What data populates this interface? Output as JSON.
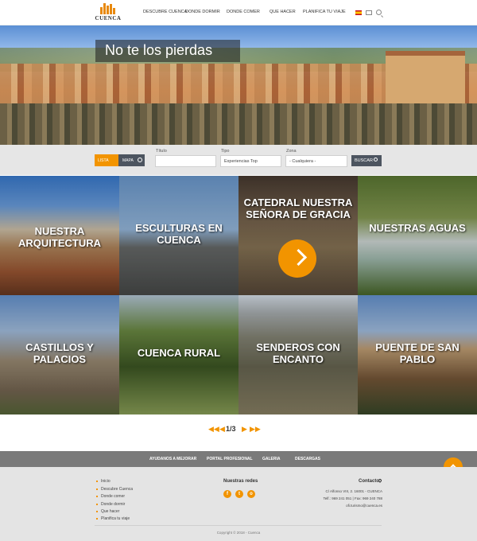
{
  "header": {
    "logo_text": "CUENCA",
    "nav": [
      "DESCUBRE CUENCA",
      "DONDE DORMIR",
      "DONDE COMER",
      "QUE HACER",
      "PLANIFICA TU VIAJE"
    ],
    "icons": [
      "spain-flag-icon",
      "mail-icon",
      "search-icon"
    ]
  },
  "hero": {
    "title": "No te los pierdas"
  },
  "filter": {
    "lista_label": "LISTA",
    "mapa_label": "MAPA",
    "titulo_label": "Título",
    "titulo_value": "",
    "tipo_label": "Tipo",
    "tipo_value": "Experiencias Top",
    "zona_label": "Zona",
    "zona_value": "- Cualquiera -",
    "buscar_label": "BUSCAR"
  },
  "tiles": [
    {
      "title": "NUESTRA ARQUITECTURA"
    },
    {
      "title": "ESCULTURAS EN CUENCA"
    },
    {
      "title": "CATEDRAL NUESTRA SEÑORA DE GRACIA"
    },
    {
      "title": "NUESTRAS AGUAS"
    },
    {
      "title": "CASTILLOS Y PALACIOS"
    },
    {
      "title": "CUENCA RURAL"
    },
    {
      "title": "SENDEROS CON ENCANTO"
    },
    {
      "title": "PUENTE DE SAN PABLO"
    }
  ],
  "pagination": {
    "current": "1",
    "total": "3",
    "separator": "/"
  },
  "links_bar": [
    "AYUDANOS A MEJORAR",
    "PORTAL PROFESIONAL",
    "GALERIA",
    "DESCARGAS"
  ],
  "footer": {
    "menu": [
      "Inicio",
      "Descubre Cuenca",
      "Donde comer",
      "Donde dormir",
      "Que hacer",
      "Planifica tu viaje"
    ],
    "redes_title": "Nuestras redes",
    "social": [
      "f",
      "t",
      "o"
    ],
    "contacto_title": "Contacto",
    "contact_lines": [
      "C/ Alfonso VIII, 2. 16001 - CUENCA",
      "Telf.: 969 241 051 | Fax: 969 240 788",
      "ofi.turismo@cuenca.es"
    ],
    "copyright": "Copyright © 2018 - Cuenca"
  },
  "colors": {
    "accent": "#f29400",
    "dark": "#4d5560",
    "links_bar": "#7a7a7a",
    "footer_bg": "#e4e4e4"
  }
}
